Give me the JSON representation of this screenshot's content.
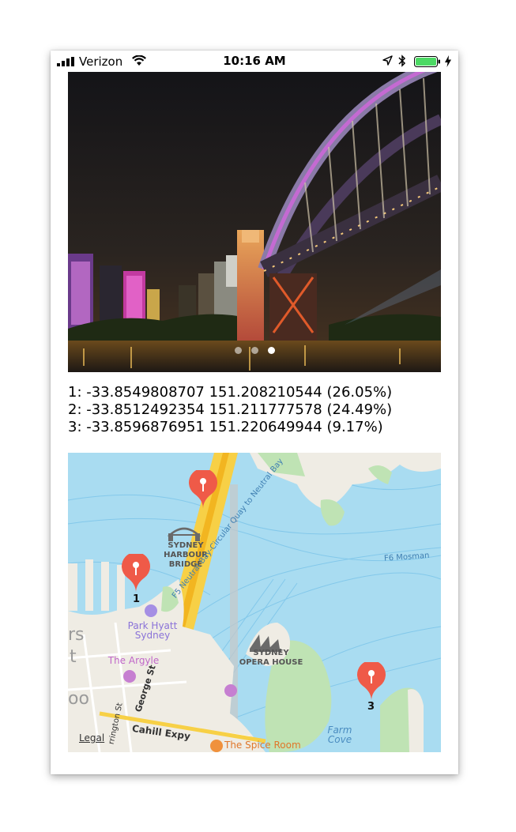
{
  "status_bar": {
    "carrier": "Verizon",
    "time": "10:16 AM",
    "battery_color": "#4cd964"
  },
  "photo": {
    "icon": "sydney-harbour-bridge-night-photo",
    "page_count": 3,
    "active_page": 3
  },
  "results": [
    {
      "text": "1: -33.8549808707 151.208210544 (26.05%)"
    },
    {
      "text": "2: -33.8512492354 151.211777578 (24.49%)"
    },
    {
      "text": "3: -33.8596876951 151.220649944 (9.17%)"
    }
  ],
  "map": {
    "water_color": "#a9dcf1",
    "land_color": "#efece4",
    "park_color": "#bfe3b4",
    "pin_color": "#ef5a48",
    "labels": {
      "bridge": "SYDNEY\nHARBOUR\nBRIDGE",
      "park_hyatt": "Park Hyatt\nSydney",
      "the_argyle": "The Argyle",
      "opera_house": "SYDNEY\nOPERA HOUSE",
      "ferry_f5": "F5 Neutral Bay-Circular Quay to Neutral Bay",
      "ferry_f6": "F6 Mosman",
      "george_st": "George St",
      "cahill_expy": "Cahill Expy",
      "harrington_st": "rrington St",
      "spice_room": "The Spice Room",
      "farm_cove": "Farm\nCove",
      "legal": "Legal",
      "edge_rs": "rs",
      "edge_t": "t",
      "edge_oo": "oo"
    },
    "pins": [
      {
        "label": ""
      },
      {
        "label": "1"
      },
      {
        "label": "3"
      }
    ]
  }
}
